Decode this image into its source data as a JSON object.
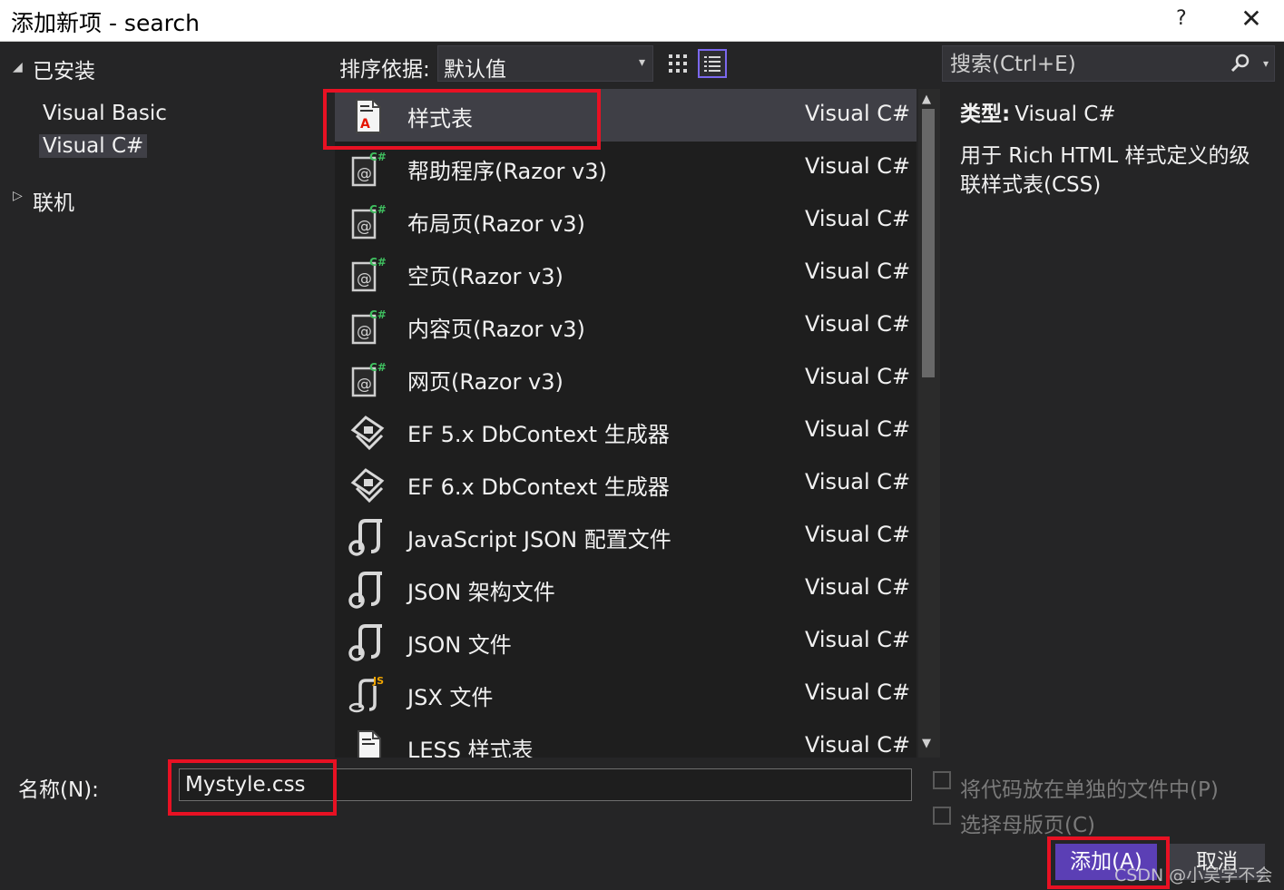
{
  "window": {
    "title": "添加新项 - search",
    "help": "?",
    "close": "✕"
  },
  "tree": {
    "installed": {
      "label": "已安装",
      "arrow": "◢"
    },
    "children": [
      {
        "label": "Visual Basic"
      },
      {
        "label": "Visual C#"
      }
    ],
    "online": {
      "label": "联机",
      "arrow": "▷"
    }
  },
  "toolbar": {
    "sort_label": "排序依据:",
    "sort_value": "默认值",
    "sort_caret": "▾",
    "grid_view_icon": "grid-icon",
    "list_view_icon": "list-icon"
  },
  "search": {
    "placeholder": "搜索(Ctrl+E)",
    "caret": "▾"
  },
  "templates": [
    {
      "name": "样式表",
      "lang": "Visual C#",
      "icon": "stylesheet"
    },
    {
      "name": "帮助程序(Razor v3)",
      "lang": "Visual C#",
      "icon": "razor"
    },
    {
      "name": "布局页(Razor v3)",
      "lang": "Visual C#",
      "icon": "razor"
    },
    {
      "name": "空页(Razor v3)",
      "lang": "Visual C#",
      "icon": "razor"
    },
    {
      "name": "内容页(Razor v3)",
      "lang": "Visual C#",
      "icon": "razor"
    },
    {
      "name": "网页(Razor v3)",
      "lang": "Visual C#",
      "icon": "razor"
    },
    {
      "name": "EF 5.x DbContext 生成器",
      "lang": "Visual C#",
      "icon": "ef"
    },
    {
      "name": "EF 6.x DbContext 生成器",
      "lang": "Visual C#",
      "icon": "ef"
    },
    {
      "name": "JavaScript JSON 配置文件",
      "lang": "Visual C#",
      "icon": "json"
    },
    {
      "name": "JSON 架构文件",
      "lang": "Visual C#",
      "icon": "json"
    },
    {
      "name": "JSON 文件",
      "lang": "Visual C#",
      "icon": "json"
    },
    {
      "name": "JSX 文件",
      "lang": "Visual C#",
      "icon": "jsx"
    },
    {
      "name": "LESS 样式表",
      "lang": "Visual C#",
      "icon": "stylesheet"
    }
  ],
  "details": {
    "type_label": "类型:",
    "type_value": "Visual C#",
    "description": "用于 Rich HTML 样式定义的级联样式表(CSS)"
  },
  "bottom": {
    "name_label": "名称(N):",
    "name_value": "Mystyle.css",
    "option_separate_file": "将代码放在单独的文件中(P)",
    "option_master_page": "选择母版页(C)",
    "add_button": "添加(A)",
    "cancel_button": "取消"
  },
  "watermark": "CSDN @小吴学不会",
  "colors": {
    "highlight": "#e81123",
    "accent": "#5b3fb5",
    "list_bg": "#1e1e1e",
    "pane_bg": "#252526"
  }
}
